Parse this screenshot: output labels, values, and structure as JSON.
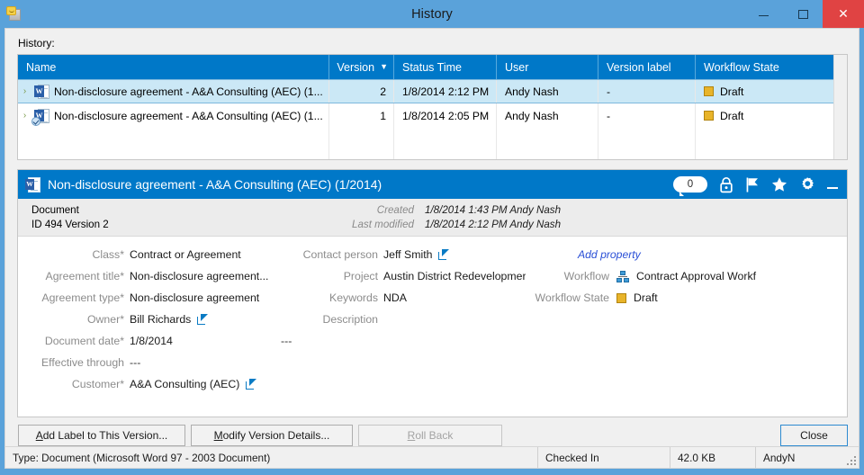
{
  "window": {
    "title": "History",
    "icon": "document-tag-icon",
    "minimize_label": "Minimize",
    "maximize_label": "Maximize",
    "close_label": "Close"
  },
  "history": {
    "label": "History:",
    "columns": [
      {
        "key": "name",
        "label": "Name",
        "sorted": false
      },
      {
        "key": "version",
        "label": "Version",
        "sorted": true,
        "sort_dir": "desc"
      },
      {
        "key": "status_time",
        "label": "Status Time",
        "sorted": false
      },
      {
        "key": "user",
        "label": "User",
        "sorted": false
      },
      {
        "key": "version_label",
        "label": "Version label",
        "sorted": false
      },
      {
        "key": "workflow_state",
        "label": "Workflow State",
        "sorted": false
      }
    ],
    "rows": [
      {
        "expander": "›",
        "icon": "word-document-icon",
        "checked_out_badge": false,
        "name": "Non-disclosure agreement - A&A Consulting (AEC) (1...",
        "version": "2",
        "status_time": "1/8/2014 2:12 PM",
        "user": "Andy Nash",
        "version_label": "-",
        "workflow_state": "Draft",
        "workflow_state_color": "#e8b42a",
        "selected": true
      },
      {
        "expander": "›",
        "icon": "word-document-icon",
        "checked_out_badge": true,
        "name": "Non-disclosure agreement - A&A Consulting (AEC) (1...",
        "version": "1",
        "status_time": "1/8/2014 2:05 PM",
        "user": "Andy Nash",
        "version_label": "-",
        "workflow_state": "Draft",
        "workflow_state_color": "#e8b42a",
        "selected": false
      }
    ]
  },
  "card": {
    "title": "Non-disclosure agreement - A&A Consulting (AEC) (1/2014)",
    "icon": "word-document-icon",
    "comment_count": "0",
    "tools": [
      "comment-bubble-icon",
      "lock-icon",
      "flag-icon",
      "star-icon",
      "gear-icon",
      "minimize-icon"
    ],
    "object_type": "Document",
    "id_version": "ID 494  Version 2",
    "created_label": "Created",
    "created_value": "1/8/2014 1:43 PM Andy Nash",
    "modified_label": "Last modified",
    "modified_value": "1/8/2014 2:12 PM Andy Nash",
    "properties_left": [
      {
        "label": "Class*",
        "value": "Contract or Agreement",
        "link": false
      },
      {
        "label": "Agreement title*",
        "value": "Non-disclosure agreement...",
        "link": false
      },
      {
        "label": "Agreement type*",
        "value": "Non-disclosure agreement",
        "link": false
      },
      {
        "label": "Owner*",
        "value": "Bill Richards",
        "link": true
      },
      {
        "label": "Document date*",
        "value": "1/8/2014",
        "link": false
      },
      {
        "label": "Effective through",
        "value": "---",
        "link": false
      },
      {
        "label": "Customer*",
        "value": "A&A Consulting (AEC)",
        "link": true
      }
    ],
    "properties_middle": [
      {
        "label": "Contact person",
        "value": "Jeff Smith",
        "link": true
      },
      {
        "label": "Project",
        "value": "Austin District Redevelopmer",
        "link": false
      },
      {
        "label": "Keywords",
        "value": "NDA",
        "link": false
      },
      {
        "label": "Description",
        "value": "",
        "link": false
      }
    ],
    "middle_extra_dashes": "---",
    "properties_right": [
      {
        "label": "",
        "value": "Add property",
        "type": "add-property"
      },
      {
        "label": "Workflow",
        "value": "Contract Approval Workf",
        "type": "workflow"
      },
      {
        "label": "Workflow State",
        "value": "Draft",
        "type": "state",
        "color": "#e8b42a"
      }
    ]
  },
  "buttons": {
    "add_label": {
      "prefix": "",
      "accel": "A",
      "suffix": "dd Label to This Version...",
      "disabled": false
    },
    "modify": {
      "prefix": "",
      "accel": "M",
      "suffix": "odify Version Details...",
      "disabled": false
    },
    "rollback": {
      "prefix": "",
      "accel": "R",
      "suffix": "oll Back",
      "disabled": true
    },
    "close": {
      "label": "Close",
      "disabled": false,
      "default": true
    }
  },
  "statusbar": {
    "type": "Type: Document (Microsoft Word 97 - 2003 Document)",
    "checkin_state": "Checked In",
    "size": "42.0 KB",
    "user": "AndyN"
  }
}
